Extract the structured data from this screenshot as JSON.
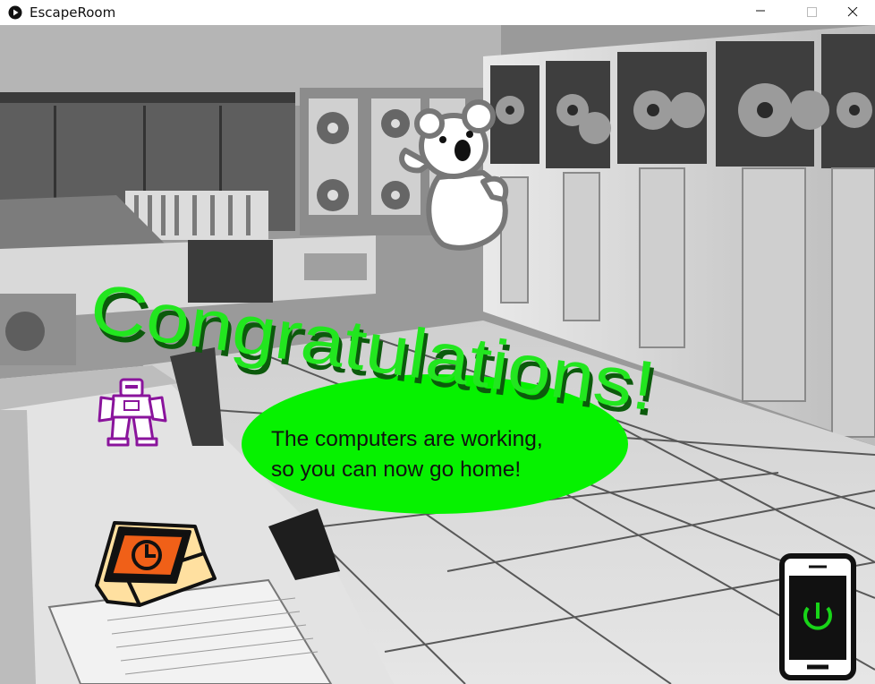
{
  "window": {
    "title": "EscapeRoom",
    "icon": "play-icon",
    "controls": [
      "minimize-icon",
      "maximize-icon",
      "close-icon"
    ]
  },
  "scene": {
    "background": "computer-room-photo",
    "heading": "Congratulations!",
    "message": {
      "line1": "The computers are working,",
      "line2": "so you can now go home!"
    },
    "items": {
      "koala": "koala-icon",
      "robot": "robot-icon",
      "book": "book-icon",
      "phone": "phone-power-icon"
    }
  },
  "colors": {
    "heading_green": "#22e61f",
    "bubble_green": "#06f200",
    "robot_purple": "#8a149c",
    "book_orange": "#f06018",
    "book_cream": "#ffe0a0",
    "phone_screen": "#111111",
    "power_green": "#18d418"
  }
}
